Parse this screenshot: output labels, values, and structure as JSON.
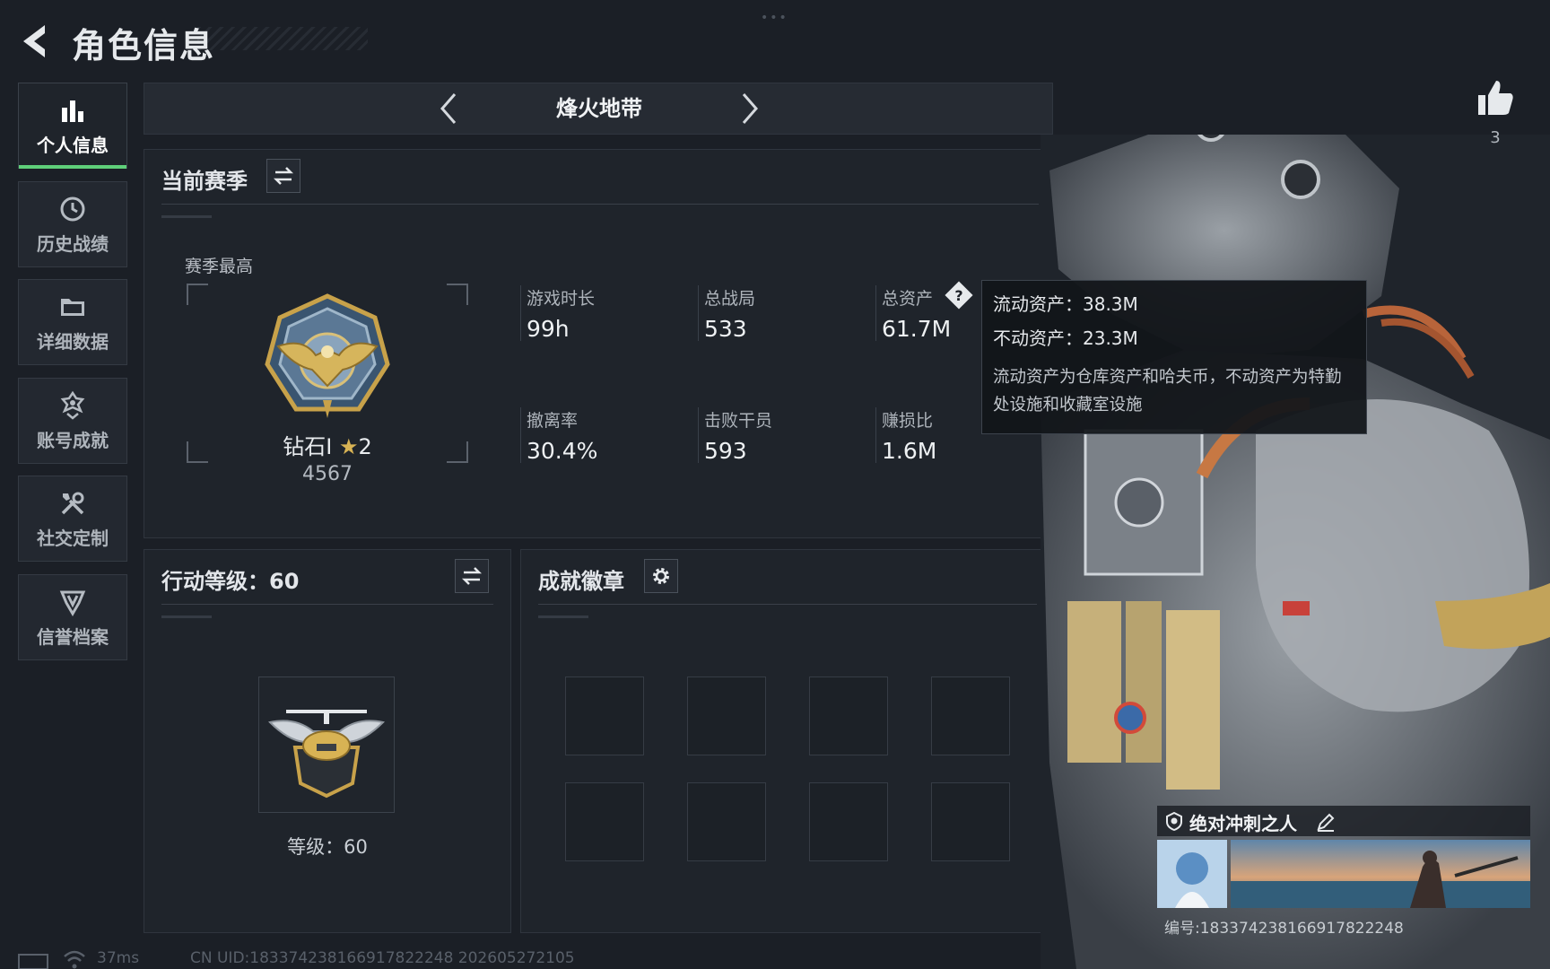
{
  "header": {
    "title": "角色信息"
  },
  "sidebar": {
    "items": [
      {
        "label": "个人信息",
        "icon": "bar-chart-icon",
        "active": true
      },
      {
        "label": "历史战绩",
        "icon": "history-icon",
        "active": false
      },
      {
        "label": "详细数据",
        "icon": "folder-icon",
        "active": false
      },
      {
        "label": "账号成就",
        "icon": "achievement-icon",
        "active": false
      },
      {
        "label": "社交定制",
        "icon": "tools-icon",
        "active": false
      },
      {
        "label": "信誉档案",
        "icon": "shield-icon",
        "active": false
      }
    ]
  },
  "mode_selector": {
    "current": "烽火地带"
  },
  "season": {
    "title": "当前赛季",
    "best_label": "赛季最高",
    "rank_name": "钻石I",
    "rank_stars": "2",
    "rank_score": "4567",
    "stats": [
      {
        "label": "游戏时长",
        "value": "99h"
      },
      {
        "label": "总战局",
        "value": "533"
      },
      {
        "label": "总资产",
        "value": "61.7M"
      },
      {
        "label": "撤离率",
        "value": "30.4%"
      },
      {
        "label": "击败干员",
        "value": "593"
      },
      {
        "label": "赚损比",
        "value": "1.6M"
      }
    ]
  },
  "tooltip": {
    "liquid": "流动资产：38.3M",
    "fixed": "不动资产：23.3M",
    "note": "流动资产为仓库资产和哈夫币，不动资产为特勤处设施和收藏室设施"
  },
  "action_level": {
    "title": "行动等级：60",
    "level_text": "等级：60"
  },
  "badges": {
    "title": "成就徽章"
  },
  "character": {
    "likes": "3",
    "name": "绝对冲刺之人",
    "id_text": "编号:1833742381669178​22248"
  },
  "footer": {
    "ping": "37ms",
    "uid": "CN UID:183374238166917822248 202605272105"
  },
  "colors": {
    "accent": "#5fd07a",
    "background": "#1b1f26",
    "panel": "#1f242b",
    "gold": "#d8b354"
  }
}
